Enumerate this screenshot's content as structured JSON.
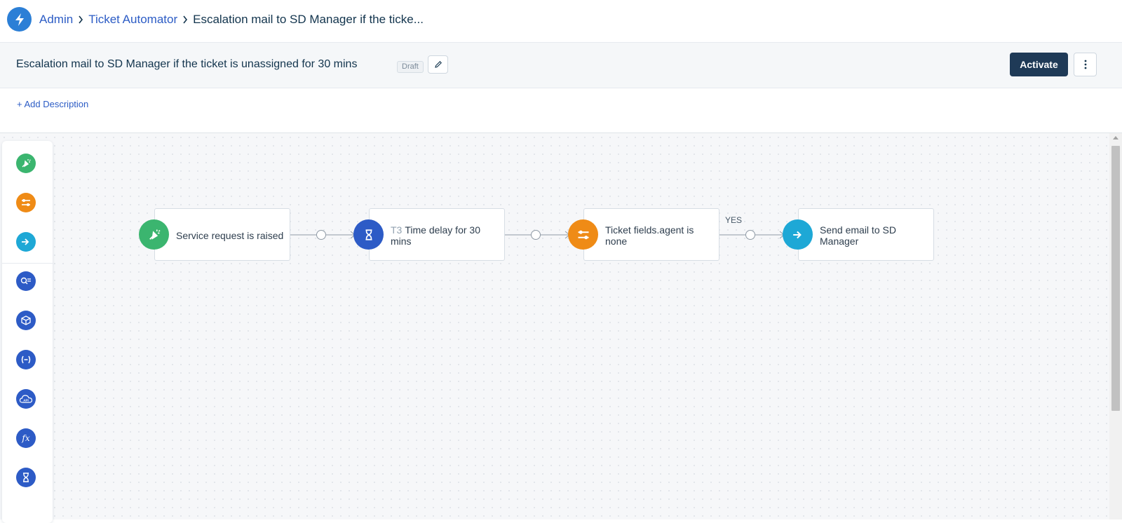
{
  "breadcrumb": {
    "items": [
      "Admin",
      "Ticket Automator"
    ],
    "current": "Escalation mail to SD Manager if the ticke..."
  },
  "workflow": {
    "title": "Escalation mail to SD Manager if the ticket is unassigned for 30 mins",
    "status_badge": "Draft",
    "activate_label": "Activate",
    "add_description_label": "+ Add Description"
  },
  "palette": {
    "items": [
      {
        "icon": "event-icon",
        "color": "#3bb56f"
      },
      {
        "icon": "condition-icon",
        "color": "#ef8b16"
      },
      {
        "icon": "action-icon",
        "color": "#1ea8d6"
      },
      {
        "icon": "reader-icon",
        "color": "#2d5bc6"
      },
      {
        "icon": "app-icon",
        "color": "#2d5bc6"
      },
      {
        "icon": "variable-icon",
        "color": "#2d5bc6"
      },
      {
        "icon": "api-icon",
        "color": "#2d5bc6"
      },
      {
        "icon": "expression-icon",
        "color": "#2d5bc6"
      },
      {
        "icon": "timer-icon",
        "color": "#2d5bc6"
      }
    ]
  },
  "flow": {
    "nodes": [
      {
        "label": "Service request is raised",
        "icon": "event-icon",
        "color": "#3bb56f"
      },
      {
        "prefix": "T3",
        "label": "Time delay for 30 mins",
        "icon": "timer-icon",
        "color": "#2d5bc6"
      },
      {
        "label": "Ticket fields.agent is none",
        "icon": "condition-icon",
        "color": "#ef8b16"
      },
      {
        "label": "Send email to SD Manager",
        "icon": "action-icon",
        "color": "#1ea8d6"
      }
    ],
    "branch_label": "YES"
  }
}
